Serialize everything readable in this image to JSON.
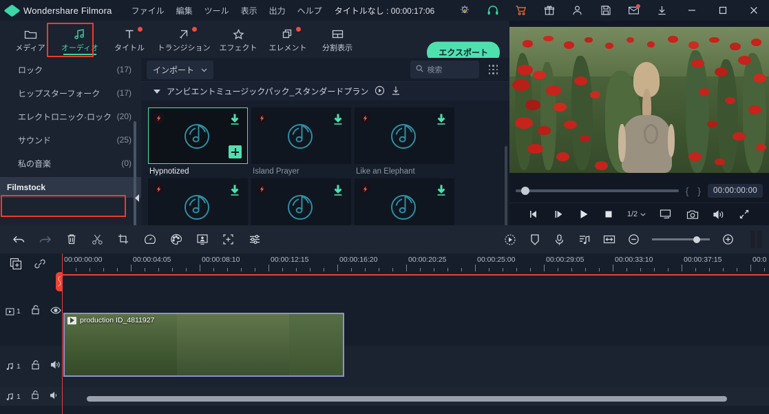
{
  "titlebar": {
    "app_name": "Wondershare Filmora",
    "menu": [
      "ファイル",
      "編集",
      "ツール",
      "表示",
      "出力",
      "ヘルプ"
    ],
    "doc_title": "タイトルなし : 00:00:17:06",
    "icons": [
      {
        "name": "lightbulb-icon"
      },
      {
        "name": "headset-icon",
        "color": "#3ad6a8"
      },
      {
        "name": "cart-icon",
        "color": "#e8652a"
      },
      {
        "name": "gift-icon"
      },
      {
        "name": "account-icon"
      },
      {
        "name": "save-icon"
      },
      {
        "name": "mail-icon",
        "badge": true
      },
      {
        "name": "download-icon"
      }
    ],
    "window_controls": [
      "minimize-icon",
      "maximize-icon",
      "close-icon"
    ]
  },
  "tabs": [
    {
      "label": "メディア",
      "icon": "folder-icon",
      "active": false,
      "dot": false
    },
    {
      "label": "オーディオ",
      "icon": "music-note-icon",
      "active": true,
      "dot": false
    },
    {
      "label": "タイトル",
      "icon": "text-t-icon",
      "active": false,
      "dot": true
    },
    {
      "label": "トランジション",
      "icon": "transition-arrows-icon",
      "active": false,
      "dot": true
    },
    {
      "label": "エフェクト",
      "icon": "sparkle-star-icon",
      "active": false,
      "dot": false
    },
    {
      "label": "エレメント",
      "icon": "layers-icon",
      "active": false,
      "dot": true
    },
    {
      "label": "分割表示",
      "icon": "split-screen-icon",
      "active": false,
      "dot": false
    }
  ],
  "export_button": "エクスポート",
  "sidebar": {
    "items": [
      {
        "label": "ロック",
        "count": "(17)"
      },
      {
        "label": "ヒップスターフォーク",
        "count": "(17)"
      },
      {
        "label": "エレクトロニック·ロック",
        "count": "(20)"
      },
      {
        "label": "サウンド",
        "count": "(25)"
      },
      {
        "label": "私の音楽",
        "count": "(0)"
      }
    ],
    "filmstock": "Filmstock"
  },
  "media_panel": {
    "import_label": "インポート",
    "search_placeholder": "検索",
    "group_label": "アンビエントミュージックパック_スタンダードプラン",
    "cards_row1": [
      {
        "name": "Hypnotized",
        "selected": true
      },
      {
        "name": "Island Prayer",
        "selected": false
      },
      {
        "name": "Like an Elephant",
        "selected": false
      }
    ],
    "cards_row2": [
      {
        "name": "",
        "selected": false
      },
      {
        "name": "",
        "selected": false
      },
      {
        "name": "",
        "selected": false
      }
    ]
  },
  "preview": {
    "timecode": "00:00:00:00",
    "speed": "1/2",
    "mark_in": "{",
    "mark_out": "}",
    "controls": [
      "prev-frame-icon",
      "next-frame-icon",
      "play-icon",
      "stop-icon",
      "speed-selector",
      "snapshot-screen-icon",
      "camera-icon",
      "volume-icon",
      "fullscreen-icon"
    ]
  },
  "timeline_toolbar": {
    "left_icons": [
      "undo-icon",
      "redo-icon",
      "delete-icon",
      "scissors-icon",
      "crop-icon",
      "speed-icon",
      "color-palette-icon",
      "green-screen-icon",
      "crop-fit-icon",
      "adjust-sliders-icon"
    ],
    "right_icons": [
      "render-preview-icon",
      "marker-icon",
      "voiceover-mic-icon",
      "audio-detach-icon",
      "fit-timeline-icon",
      "zoom-out-icon",
      "zoom-slider",
      "zoom-in-icon",
      "pause-bars-icon"
    ]
  },
  "timeline": {
    "head_icons": [
      "add-media-icon",
      "link-icon"
    ],
    "ruler_labels": [
      "00:00:00:00",
      "00:00:04:05",
      "00:00:08:10",
      "00:00:12:15",
      "00:00:16:20",
      "00:00:20:25",
      "00:00:25:00",
      "00:00:29:05",
      "00:00:33:10",
      "00:00:37:15",
      "00:0"
    ],
    "tracks": [
      {
        "num": "1",
        "type_icon": "video-track-icon",
        "lock_icon": "unlock-icon",
        "vis_icon": "eye-icon"
      },
      {
        "num": "1",
        "type_icon": "audio-track-icon",
        "lock_icon": "unlock-icon",
        "vis_icon": "speaker-icon"
      },
      {
        "num": "1",
        "type_icon": "audio-track-icon",
        "lock_icon": "unlock-icon",
        "vis_icon": "speaker-icon"
      }
    ],
    "clip": {
      "label": "production ID_4811927"
    }
  },
  "colors": {
    "accent_teal": "#4fe0b0",
    "highlight_red": "#ef3b2d",
    "playhead_red": "#ef4033",
    "panel_bg": "#161d2b",
    "window_bg": "#1b2230"
  }
}
